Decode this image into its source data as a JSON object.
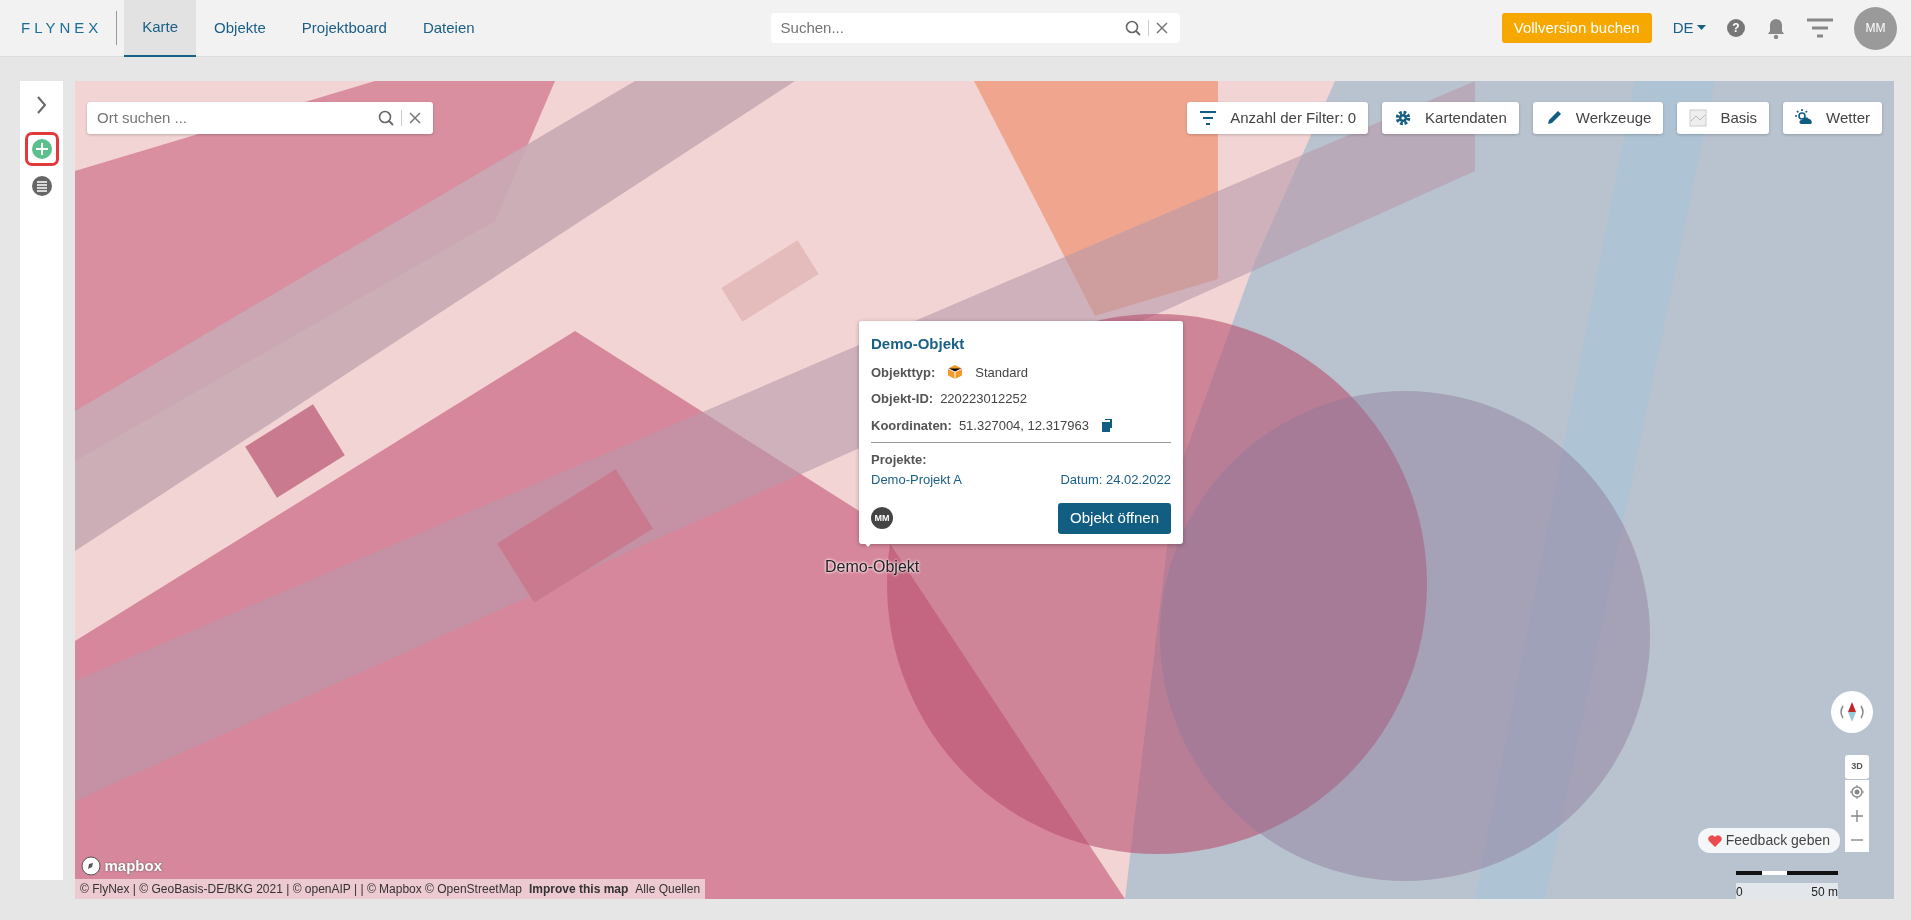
{
  "navbar": {
    "logo": "FLYNEX",
    "tabs": [
      {
        "label": "Karte",
        "selected": true
      },
      {
        "label": "Objekte",
        "selected": false
      },
      {
        "label": "Projektboard",
        "selected": false
      },
      {
        "label": "Dateien",
        "selected": false
      }
    ],
    "search": {
      "placeholder": "Suchen..."
    },
    "upgrade_button": "Vollversion buchen",
    "language": "DE",
    "help_label": "?",
    "user_initials": "MM"
  },
  "sidebar": {
    "items": [
      {
        "kind": "expand",
        "highlighted": false
      },
      {
        "kind": "add",
        "highlighted": true
      },
      {
        "kind": "list",
        "highlighted": false
      }
    ]
  },
  "map": {
    "place_search": {
      "placeholder": "Ort suchen ..."
    },
    "toolbar": [
      {
        "kind": "filter",
        "label": "Anzahl der Filter: 0"
      },
      {
        "kind": "gear",
        "label": "Kartendaten"
      },
      {
        "kind": "pencil",
        "label": "Werkzeuge"
      },
      {
        "kind": "basemap",
        "label": "Basis"
      },
      {
        "kind": "weather",
        "label": "Wetter"
      }
    ],
    "marker_label": "Demo-Objekt",
    "popup": {
      "title": "Demo-Objekt",
      "fields": [
        {
          "kind": "type",
          "label": "Objekttyp:",
          "value": "Standard"
        },
        {
          "kind": "plain",
          "label": "Objekt-ID:",
          "value": "220223012252"
        },
        {
          "kind": "copy",
          "label": "Koordinaten:",
          "value": "51.327004, 12.317963"
        }
      ],
      "projects_label": "Projekte:",
      "project": "Demo-Projekt A",
      "date": "Datum: 24.02.2022",
      "owner_initials": "MM",
      "open_button": "Objekt öffnen"
    },
    "pitch_button": "3D",
    "feedback_button": "Feedback geben",
    "scale": {
      "start": "0",
      "end": "50 m"
    },
    "mapbox_logo": "mapbox",
    "attribution": {
      "text": "© FlyNex | © GeoBasis-DE/BKG 2021 | © openAIP | | © Mapbox © OpenStreetMap",
      "improve_link": "Improve this map",
      "sources_link": "Alle Quellen"
    }
  }
}
